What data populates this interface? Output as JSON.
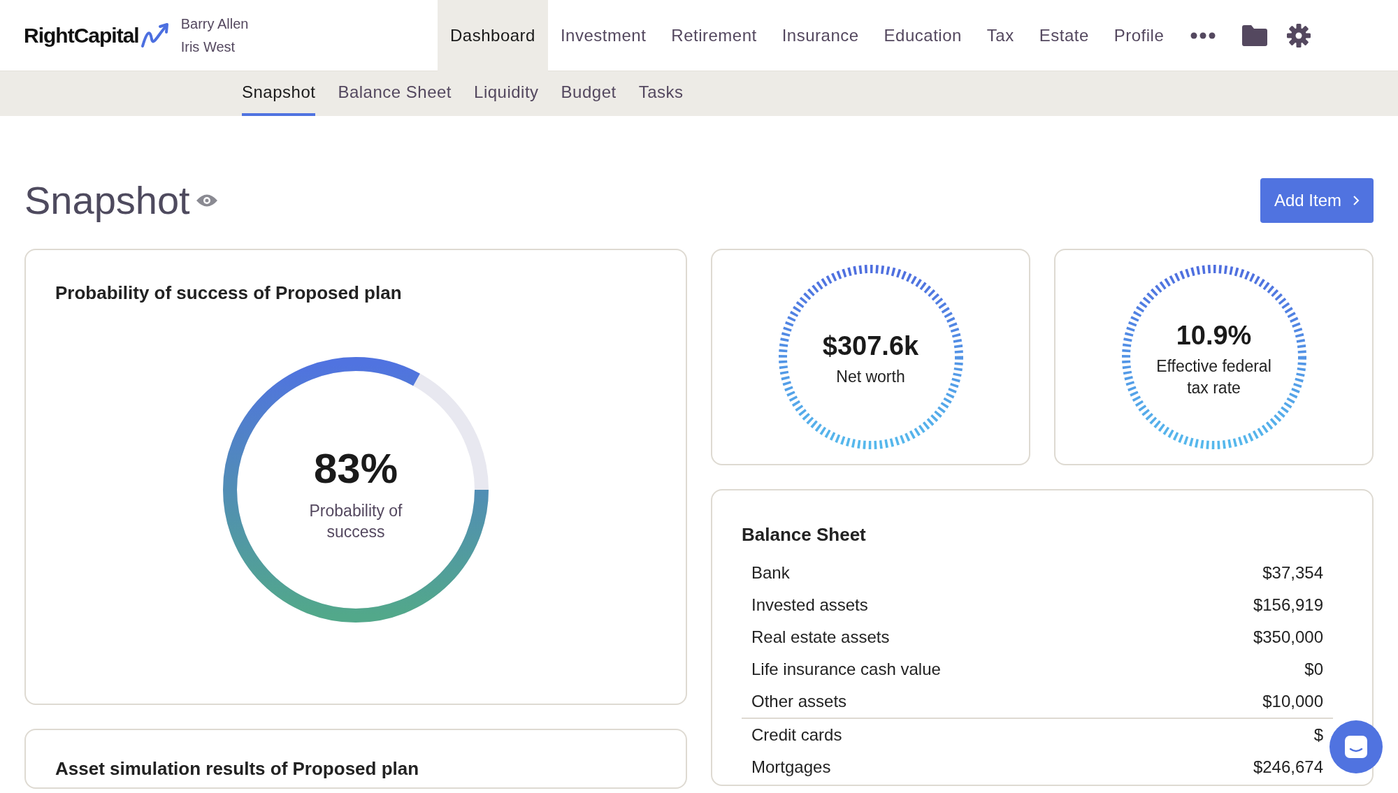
{
  "app": {
    "logo": "RightCapital",
    "clients": [
      "Barry Allen",
      "Iris West"
    ]
  },
  "main_nav": [
    {
      "label": "Dashboard",
      "selected": true
    },
    {
      "label": "Investment",
      "selected": false
    },
    {
      "label": "Retirement",
      "selected": false
    },
    {
      "label": "Insurance",
      "selected": false
    },
    {
      "label": "Education",
      "selected": false
    },
    {
      "label": "Tax",
      "selected": false
    },
    {
      "label": "Estate",
      "selected": false
    },
    {
      "label": "Profile",
      "selected": false
    }
  ],
  "sub_nav": [
    {
      "label": "Snapshot",
      "selected": true
    },
    {
      "label": "Balance Sheet",
      "selected": false
    },
    {
      "label": "Liquidity",
      "selected": false
    },
    {
      "label": "Budget",
      "selected": false
    },
    {
      "label": "Tasks",
      "selected": false
    }
  ],
  "page": {
    "title": "Snapshot",
    "add_button": "Add Item"
  },
  "probability_card": {
    "title": "Probability of success of Proposed plan",
    "value": "83%",
    "caption": "Probability of success",
    "level": 0.83
  },
  "metrics": [
    {
      "value": "$307.6k",
      "caption": "Net worth"
    },
    {
      "value": "10.9%",
      "caption": "Effective federal tax rate"
    }
  ],
  "balance_sheet": {
    "title": "Balance Sheet",
    "groups": [
      {
        "rows": [
          {
            "label": "Bank",
            "value": "$37,354"
          },
          {
            "label": "Invested assets",
            "value": "$156,919"
          },
          {
            "label": "Real estate assets",
            "value": "$350,000"
          },
          {
            "label": "Life insurance cash value",
            "value": "$0"
          },
          {
            "label": "Other assets",
            "value": "$10,000"
          }
        ]
      },
      {
        "rows": [
          {
            "label": "Credit cards",
            "value": "$"
          },
          {
            "label": "Mortgages",
            "value": "$246,674"
          }
        ]
      }
    ]
  },
  "asset_card": {
    "title": "Asset simulation results of Proposed plan"
  }
}
